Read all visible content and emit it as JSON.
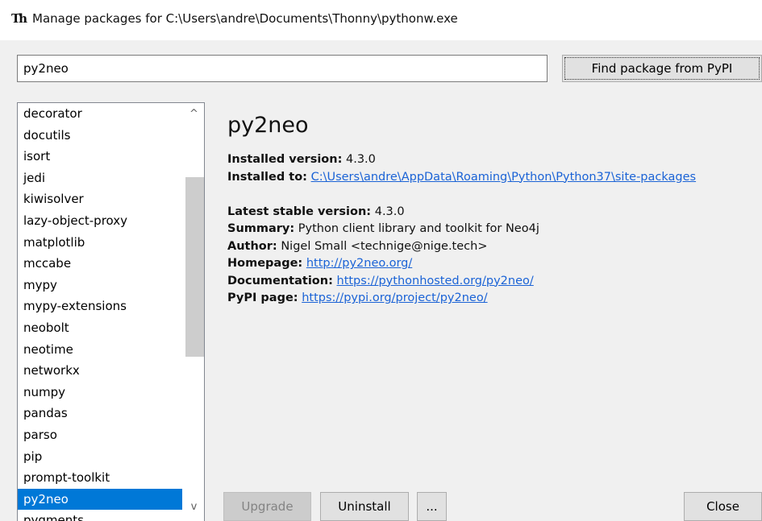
{
  "window": {
    "icon": "Th",
    "title": "Manage packages for C:\\Users\\andre\\Documents\\Thonny\\pythonw.exe"
  },
  "search": {
    "value": "py2neo",
    "button_label": "Find package from PyPI"
  },
  "package_list": {
    "items": [
      "decorator",
      "docutils",
      "isort",
      "jedi",
      "kiwisolver",
      "lazy-object-proxy",
      "matplotlib",
      "mccabe",
      "mypy",
      "mypy-extensions",
      "neobolt",
      "neotime",
      "networkx",
      "numpy",
      "pandas",
      "parso",
      "pip",
      "prompt-toolkit",
      "py2neo",
      "pygments"
    ],
    "selected": "py2neo",
    "scroll_up_glyph": "^",
    "scroll_down_glyph": "v"
  },
  "details": {
    "name": "py2neo",
    "installed_version_label": "Installed version:",
    "installed_version": "4.3.0",
    "installed_to_label": "Installed to:",
    "installed_to": "C:\\Users\\andre\\AppData\\Roaming\\Python\\Python37\\site-packages",
    "latest_version_label": "Latest stable version:",
    "latest_version": "4.3.0",
    "summary_label": "Summary:",
    "summary": "Python client library and toolkit for Neo4j",
    "author_label": "Author:",
    "author": "Nigel Small <technige@nige.tech>",
    "homepage_label": "Homepage:",
    "homepage": "http://py2neo.org/",
    "documentation_label": "Documentation:",
    "documentation": "https://pythonhosted.org/py2neo/",
    "pypi_label": "PyPI page:",
    "pypi": "https://pypi.org/project/py2neo/"
  },
  "buttons": {
    "upgrade": "Upgrade",
    "uninstall": "Uninstall",
    "more": "...",
    "close": "Close"
  },
  "colors": {
    "selection": "#0078d7",
    "link": "#1b63d6"
  }
}
